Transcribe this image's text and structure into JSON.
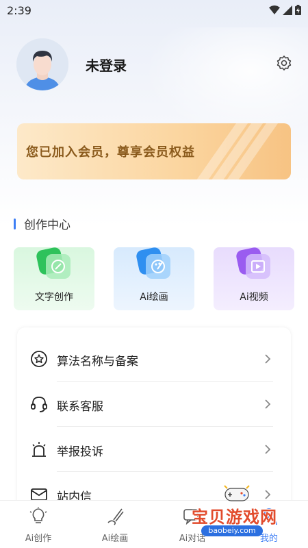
{
  "status_bar": {
    "time": "2:39"
  },
  "profile": {
    "username": "未登录"
  },
  "vip_banner": {
    "text": "您已加入会员，尊享会员权益"
  },
  "creation_center": {
    "title": "创作中心",
    "cards": [
      {
        "label": "文字创作",
        "icon": "pen-icon"
      },
      {
        "label": "Ai绘画",
        "icon": "palette-icon"
      },
      {
        "label": "Ai视频",
        "icon": "video-icon"
      }
    ]
  },
  "menu": {
    "items": [
      {
        "label": "算法名称与备案",
        "icon": "star-badge-icon"
      },
      {
        "label": "联系客服",
        "icon": "headset-icon"
      },
      {
        "label": "举报投诉",
        "icon": "alarm-icon"
      },
      {
        "label": "站内信",
        "icon": "mail-icon"
      }
    ]
  },
  "bottom_nav": {
    "items": [
      {
        "label": "Ai创作",
        "icon": "lightbulb-icon"
      },
      {
        "label": "Ai绘画",
        "icon": "brush-icon"
      },
      {
        "label": "Ai对话",
        "icon": "chat-icon"
      },
      {
        "label": "我的",
        "icon": "person-icon",
        "active": true
      }
    ]
  },
  "watermark": {
    "title": "宝贝游戏网",
    "url": "baobeiy.com"
  },
  "colors": {
    "accent": "#3d7ef5",
    "vip_text": "#8a5a1c",
    "watermark_red": "#e24b2c"
  }
}
